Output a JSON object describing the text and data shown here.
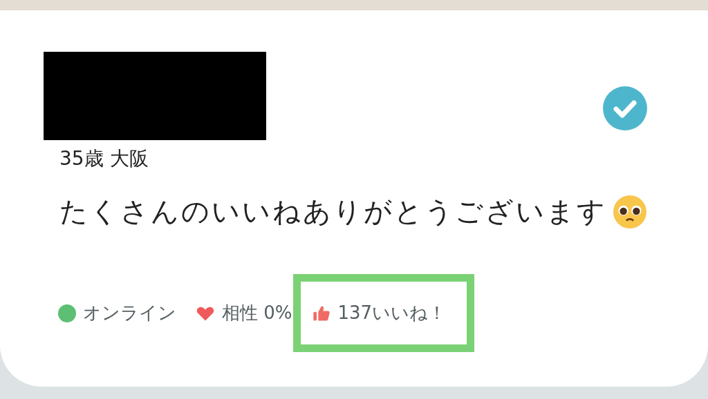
{
  "profile": {
    "verified": true,
    "age_location": "35歳 大阪",
    "message": "たくさんのいいねありがとうございます",
    "stats": [
      {
        "kind": "status",
        "label": "オンライン",
        "color": "#5cbf74"
      },
      {
        "kind": "compatibility",
        "label": "相性 0%"
      },
      {
        "kind": "likes",
        "label": "137いいね！",
        "highlighted": true
      }
    ]
  }
}
